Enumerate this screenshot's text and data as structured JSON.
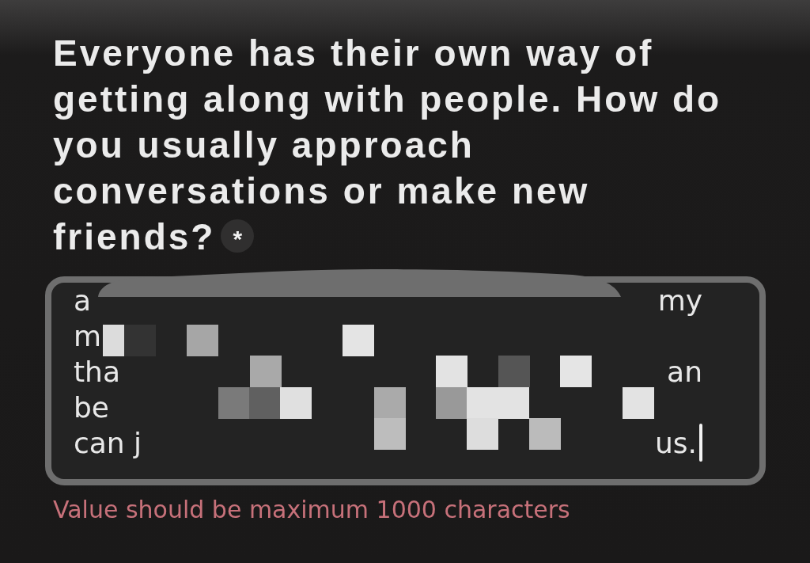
{
  "question": {
    "text": "Everyone has their own way of getting along with people. How do you usually approach conversations or make new friends?",
    "required": true,
    "required_mark": "*"
  },
  "answer": {
    "focused": true,
    "lines": [
      {
        "left": "a",
        "right": "my"
      },
      {
        "left": "m"
      },
      {
        "left": "tha",
        "right": "an"
      },
      {
        "left": "be"
      },
      {
        "left": "can j",
        "right": "us."
      }
    ]
  },
  "error": "Value should be maximum 1000 characters"
}
